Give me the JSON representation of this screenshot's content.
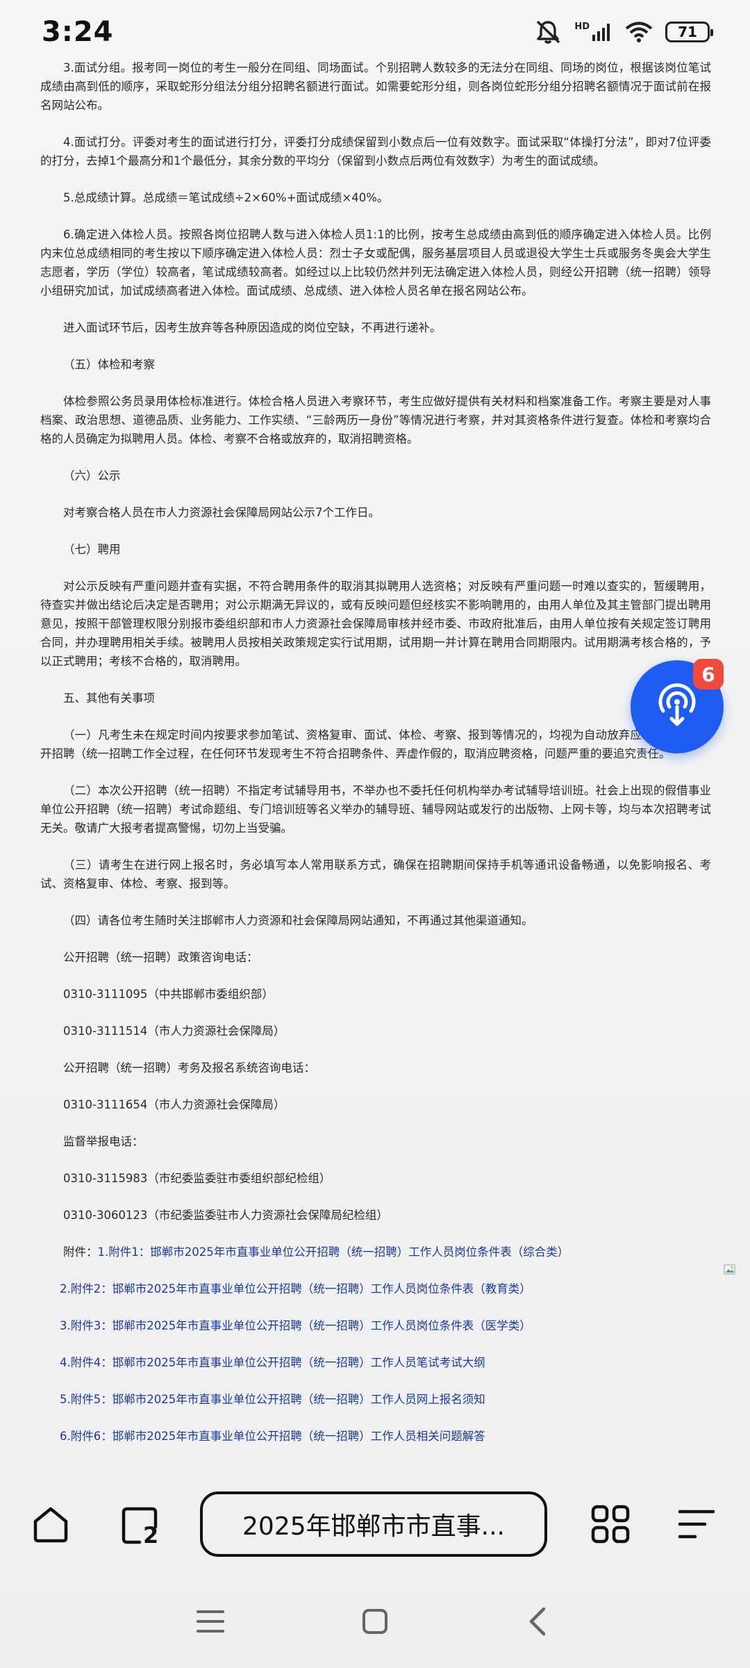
{
  "status": {
    "time": "3:24",
    "battery": "71",
    "network_label": "HD"
  },
  "article": {
    "paragraphs": [
      "3.面试分组。报考同一岗位的考生一般分在同组、同场面试。个别招聘人数较多的无法分在同组、同场的岗位，根据该岗位笔试成绩由高到低的顺序，采取蛇形分组法分组分招聘名额进行面试。如需要蛇形分组，则各岗位蛇形分组分招聘名额情况于面试前在报名网站公布。",
      "4.面试打分。评委对考生的面试进行打分，评委打分成绩保留到小数点后一位有效数字。面试采取“体操打分法”，即对7位评委的打分，去掉1个最高分和1个最低分，其余分数的平均分（保留到小数点后两位有效数字）为考生的面试成绩。",
      "5.总成绩计算。总成绩＝笔试成绩÷2×60%+面试成绩×40%。",
      "6.确定进入体检人员。按照各岗位招聘人数与进入体检人员1:1的比例，按考生总成绩由高到低的顺序确定进入体检人员。比例内末位总成绩相同的考生按以下顺序确定进入体检人员：烈士子女或配偶，服务基层项目人员或退役大学生士兵或服务冬奥会大学生志愿者，学历（学位）较高者，笔试成绩较高者。如经过以上比较仍然并列无法确定进入体检人员，则经公开招聘（统一招聘）领导小组研究加试，加试成绩高者进入体检。面试成绩、总成绩、进入体检人员名单在报名网站公布。",
      "进入面试环节后，因考生放弃等各种原因造成的岗位空缺，不再进行递补。",
      "（五）体检和考察",
      "体检参照公务员录用体检标准进行。体检合格人员进入考察环节，考生应做好提供有关材料和档案准备工作。考察主要是对人事档案、政治思想、道德品质、业务能力、工作实绩、“三龄两历一身份”等情况进行考察，并对其资格条件进行复查。体检和考察均合格的人员确定为拟聘用人员。体检、考察不合格或放弃的，取消招聘资格。",
      "（六）公示",
      "对考察合格人员在市人力资源社会保障局网站公示7个工作日。",
      "（七）聘用",
      "对公示反映有严重问题并查有实据，不符合聘用条件的取消其拟聘用人选资格；对反映有严重问题一时难以查实的，暂缓聘用，待查实并做出结论后决定是否聘用；对公示期满无异议的，或有反映问题但经核实不影响聘用的，由用人单位及其主管部门提出聘用意见，按照干部管理权限分别报市委组织部和市人力资源社会保障局审核并经市委、市政府批准后，由用人单位按有关规定签订聘用合同，并办理聘用相关手续。被聘用人员按相关政策规定实行试用期，试用期一并计算在聘用合同期限内。试用期满考核合格的，予以正式聘用；考核不合格的，取消聘用。",
      "五、其他有关事项",
      "（一）凡考生未在规定时间内按要求参加笔试、资格复审、面试、体检、考察、报到等情况的，均视为自动放弃应聘资格；在公开招聘（统一招聘工作全过程，在任何环节发现考生不符合招聘条件、弄虚作假的，取消应聘资格，问题严重的要追究责任。",
      "（二）本次公开招聘（统一招聘）不指定考试辅导用书，不举办也不委托任何机构举办考试辅导培训班。社会上出现的假借事业单位公开招聘（统一招聘）考试命题组、专门培训班等名义举办的辅导班、辅导网站或发行的出版物、上网卡等，均与本次招聘考试无关。敬请广大报考者提高警惕，切勿上当受骗。",
      "（三）请考生在进行网上报名时，务必填写本人常用联系方式，确保在招聘期间保持手机等通讯设备畅通，以免影响报名、考试、资格复审、体检、考察、报到等。",
      "（四）请各位考生随时关注邯郸市人力资源和社会保障局网站通知，不再通过其他渠道通知。",
      "公开招聘（统一招聘）政策咨询电话：",
      "0310-3111095（中共邯郸市委组织部）",
      "0310-3111514（市人力资源社会保障局）",
      "公开招聘（统一招聘）考务及报名系统咨询电话：",
      "0310-3111654（市人力资源社会保障局）",
      "监督举报电话：",
      "0310-3115983（市纪委监委驻市委组织部纪检组）",
      "0310-3060123（市纪委监委驻市人力资源社会保障局纪检组）"
    ],
    "attachments_prefix": "附件：",
    "attachments": [
      {
        "num": "1.",
        "text": "附件1：邯郸市2025年市直事业单位公开招聘（统一招聘）工作人员岗位条件表（综合类）"
      },
      {
        "num": "2.",
        "text": "附件2：邯郸市2025年市直事业单位公开招聘（统一招聘）工作人员岗位条件表（教育类）"
      },
      {
        "num": "3.",
        "text": "附件3：邯郸市2025年市直事业单位公开招聘（统一招聘）工作人员岗位条件表（医学类）"
      },
      {
        "num": "4.",
        "text": "附件4：邯郸市2025年市直事业单位公开招聘（统一招聘）工作人员笔试考试大纲"
      },
      {
        "num": "5.",
        "text": "附件5：邯郸市2025年市直事业单位公开招聘（统一招聘）工作人员网上报名须知"
      },
      {
        "num": "6.",
        "text": "附件6：邯郸市2025年市直事业单位公开招聘（统一招聘）工作人员相关问题解答"
      }
    ]
  },
  "fab": {
    "badge_count": "6",
    "icon": "podcast-download-icon",
    "color": "#1f5cf1"
  },
  "browser_bar": {
    "url_title": "2025年邯郸市市直事...",
    "tab_count": "2",
    "icons": [
      "home-icon",
      "tabs-icon",
      "apps-grid-icon",
      "menu-icon"
    ]
  },
  "system_nav": {
    "icons": [
      "recent-apps-icon",
      "home-square-icon",
      "back-icon"
    ]
  },
  "colors": {
    "link": "#1a3aa8",
    "badge": "#ef4a3b"
  }
}
